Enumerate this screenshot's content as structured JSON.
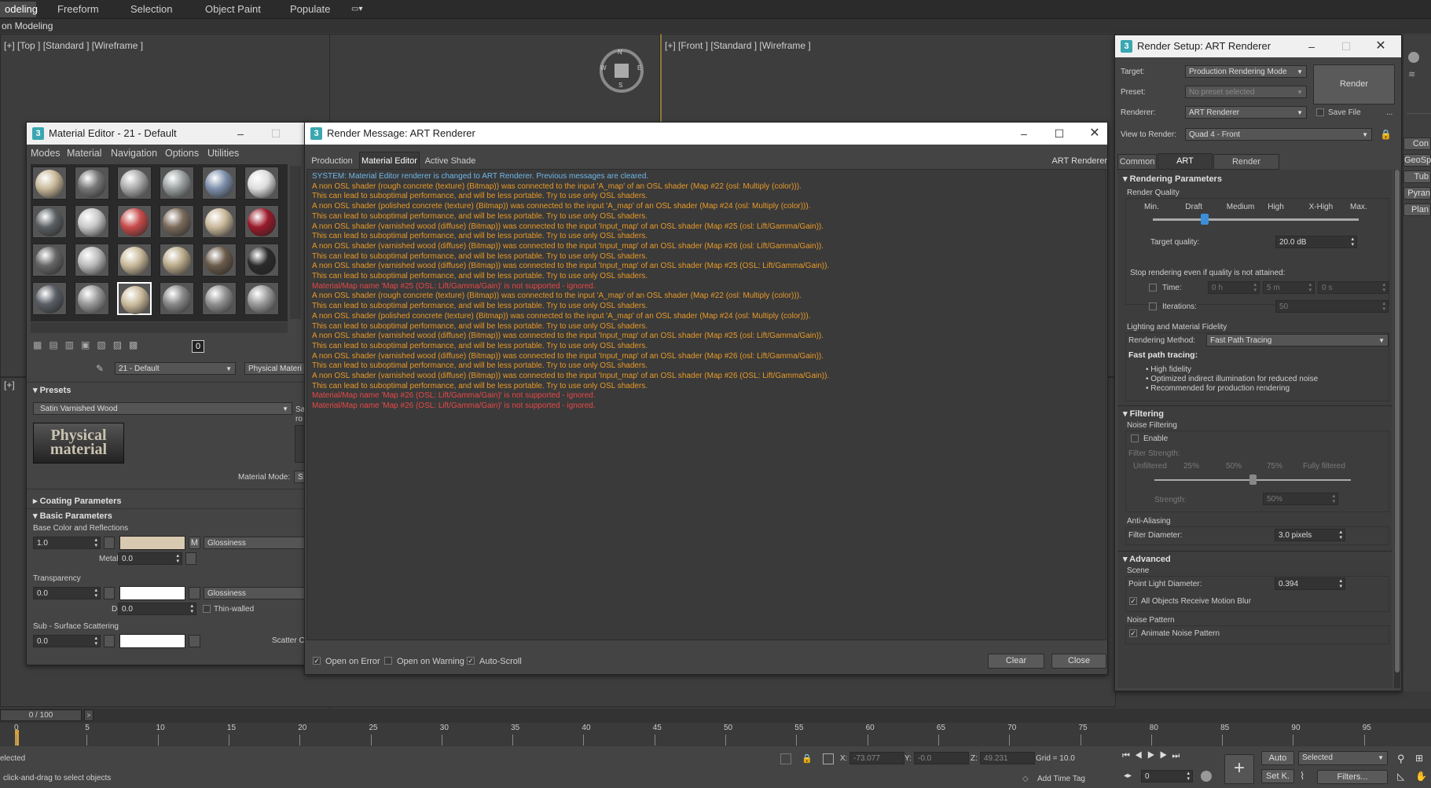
{
  "ribbon": {
    "tabs": [
      "odeling",
      "Freeform",
      "Selection",
      "Object Paint",
      "Populate"
    ],
    "sub_label": "on Modeling"
  },
  "viewports": {
    "top_label": "[+] [Top ] [Standard ] [Wireframe ]",
    "front_label": "[+] [Front ] [Standard ] [Wireframe ]",
    "third_label": "[+]",
    "compass": {
      "n": "N",
      "s": "S",
      "w": "W",
      "e": "E"
    }
  },
  "material_editor": {
    "title": "Material Editor - 21 - Default",
    "menu": [
      "Modes",
      "Material",
      "Navigation",
      "Options",
      "Utilities"
    ],
    "toolbar_count": "0",
    "material_name": "21 - Default",
    "material_type": "Physical Materi",
    "presets_label": "Presets",
    "preset_value": "Satin Varnished Wood",
    "logo_text": "Physical material",
    "material_mode_label": "Material Mode:",
    "material_mode_value": "S",
    "coating_label": "Coating Parameters",
    "basic_label": "Basic Parameters",
    "base_color_label": "Base Color and Reflections",
    "base_weight": "1.0",
    "m_label": "M",
    "glossiness_label": "Glossiness",
    "metalness_label": "Metalness:",
    "metalness_value": "0.0",
    "transparency_label": "Transparency",
    "transparency_value": "0.0",
    "glossiness2_label": "Glossiness",
    "depth_label": "Depth:",
    "depth_value": "0.0",
    "thin_walled_label": "Thin-walled",
    "sss_label": "Sub - Surface Scattering",
    "sss_value": "0.0",
    "scatter_label": "Scatter C",
    "side_text": [
      "Sa",
      "ro"
    ]
  },
  "render_message": {
    "title": "Render Message: ART Renderer",
    "tabs": [
      "Production",
      "Material Editor",
      "Active Shade"
    ],
    "renderer_label": "ART Renderer",
    "messages": [
      {
        "type": "sys",
        "text": "SYSTEM: Material Editor renderer is changed to ART Renderer. Previous messages are cleared."
      },
      {
        "type": "warn",
        "text": "A non OSL shader (rough concrete (texture) (Bitmap)) was connected to the input 'A_map' of an OSL shader (Map #22 (osl: Multiply (color)))."
      },
      {
        "type": "warn",
        "text": "This can lead to suboptimal performance, and will be less portable. Try to use only OSL shaders."
      },
      {
        "type": "warn",
        "text": "A non OSL shader (polished concrete (texture) (Bitmap)) was connected to the input 'A_map' of an OSL shader (Map #24 (osl: Multiply (color)))."
      },
      {
        "type": "warn",
        "text": "This can lead to suboptimal performance, and will be less portable. Try to use only OSL shaders."
      },
      {
        "type": "warn",
        "text": "A non OSL shader (varnished wood (diffuse) (Bitmap)) was connected to the input 'Input_map' of an OSL shader (Map #25 (osl: Lift/Gamma/Gain))."
      },
      {
        "type": "warn",
        "text": "This can lead to suboptimal performance, and will be less portable. Try to use only OSL shaders."
      },
      {
        "type": "warn",
        "text": "A non OSL shader (varnished wood (diffuse) (Bitmap)) was connected to the input 'Input_map' of an OSL shader (Map #26 (osl: Lift/Gamma/Gain))."
      },
      {
        "type": "warn",
        "text": "This can lead to suboptimal performance, and will be less portable. Try to use only OSL shaders."
      },
      {
        "type": "warn",
        "text": "A non OSL shader (varnished wood (diffuse) (Bitmap)) was connected to the input 'Input_map' of an OSL shader (Map #25 (OSL: Lift/Gamma/Gain))."
      },
      {
        "type": "warn",
        "text": "This can lead to suboptimal performance, and will be less portable. Try to use only OSL shaders."
      },
      {
        "type": "err",
        "text": "Material/Map name 'Map #25 (OSL: Lift/Gamma/Gain)' is not supported - ignored."
      },
      {
        "type": "warn",
        "text": "A non OSL shader (rough concrete (texture) (Bitmap)) was connected to the input 'A_map' of an OSL shader (Map #22 (osl: Multiply (color)))."
      },
      {
        "type": "warn",
        "text": "This can lead to suboptimal performance, and will be less portable. Try to use only OSL shaders."
      },
      {
        "type": "warn",
        "text": "A non OSL shader (polished concrete (texture) (Bitmap)) was connected to the input 'A_map' of an OSL shader (Map #24 (osl: Multiply (color)))."
      },
      {
        "type": "warn",
        "text": "This can lead to suboptimal performance, and will be less portable. Try to use only OSL shaders."
      },
      {
        "type": "warn",
        "text": "A non OSL shader (varnished wood (diffuse) (Bitmap)) was connected to the input 'Input_map' of an OSL shader (Map #25 (osl: Lift/Gamma/Gain))."
      },
      {
        "type": "warn",
        "text": "This can lead to suboptimal performance, and will be less portable. Try to use only OSL shaders."
      },
      {
        "type": "warn",
        "text": "A non OSL shader (varnished wood (diffuse) (Bitmap)) was connected to the input 'Input_map' of an OSL shader (Map #26 (osl: Lift/Gamma/Gain))."
      },
      {
        "type": "warn",
        "text": "This can lead to suboptimal performance, and will be less portable. Try to use only OSL shaders."
      },
      {
        "type": "warn",
        "text": "A non OSL shader (varnished wood (diffuse) (Bitmap)) was connected to the input 'Input_map' of an OSL shader (Map #26 (OSL: Lift/Gamma/Gain))."
      },
      {
        "type": "warn",
        "text": "This can lead to suboptimal performance, and will be less portable. Try to use only OSL shaders."
      },
      {
        "type": "err",
        "text": "Material/Map name 'Map #26 (OSL: Lift/Gamma/Gain)' is not supported - ignored."
      },
      {
        "type": "err",
        "text": "Material/Map name 'Map #26 (OSL: Lift/Gamma/Gain)' is not supported - ignored."
      }
    ],
    "open_on_error": "Open on Error",
    "open_on_warning": "Open on Warning",
    "auto_scroll": "Auto-Scroll",
    "clear_label": "Clear",
    "close_label": "Close"
  },
  "render_setup": {
    "title": "Render Setup: ART Renderer",
    "target_label": "Target:",
    "target_value": "Production Rendering Mode",
    "preset_label": "Preset:",
    "preset_value": "No preset selected",
    "renderer_label": "Renderer:",
    "renderer_value": "ART Renderer",
    "save_file_label": "Save File",
    "more_label": "...",
    "render_label": "Render",
    "view_label": "View to Render:",
    "view_value": "Quad 4 - Front",
    "tabs": [
      "Common",
      "ART Renderer",
      "Render Elements"
    ],
    "rendering_params": "Rendering Parameters",
    "render_quality": "Render Quality",
    "quality_levels": [
      "Min.",
      "Draft",
      "Medium",
      "High",
      "X-High",
      "Max."
    ],
    "quality_level": 0.1,
    "target_quality_label": "Target quality:",
    "target_quality_value": "20.0 dB",
    "stop_label": "Stop rendering even if quality is not attained:",
    "time_label": "Time:",
    "time_values": [
      "0 h",
      "5 m",
      "0 s"
    ],
    "iterations_label": "Iterations:",
    "iterations_value": "50",
    "lighting_label": "Lighting and Material Fidelity",
    "method_label": "Rendering Method:",
    "method_value": "Fast Path Tracing",
    "fast_path_label": "Fast path tracing:",
    "fast_path_bullets": [
      "High fidelity",
      "Optimized indirect illumination for reduced noise",
      "Recommended for production rendering"
    ],
    "filtering_label": "Filtering",
    "noise_filtering_label": "Noise Filtering",
    "enable_label": "Enable",
    "filter_strength_label": "Filter Strength:",
    "filter_levels": [
      "Unfiltered",
      "25%",
      "50%",
      "75%",
      "Fully filtered"
    ],
    "filter_strength_level": 0.5,
    "strength_label": "Strength:",
    "strength_value": "50%",
    "antialiasing_label": "Anti-Aliasing",
    "filter_diameter_label": "Filter Diameter:",
    "filter_diameter_value": "3.0 pixels",
    "advanced_label": "Advanced",
    "scene_label": "Scene",
    "point_light_label": "Point Light Diameter:",
    "point_light_value": "0.394",
    "motion_blur_label": "All Objects Receive Motion Blur",
    "noise_pattern_label": "Noise Pattern",
    "animate_noise_label": "Animate Noise Pattern"
  },
  "right_panel": [
    "Con",
    "GeoSph",
    "Tub",
    "Pyran",
    "Plan"
  ],
  "timeline": {
    "frame_label": "0 / 100",
    "ticks": [
      "0",
      "5",
      "10",
      "15",
      "20",
      "25",
      "30",
      "35",
      "40",
      "45",
      "50",
      "55",
      "60",
      "65",
      "70",
      "75",
      "80",
      "85",
      "90",
      "95",
      "10"
    ]
  },
  "status": {
    "selected_text": "elected",
    "hint_text": "click-and-drag to select objects",
    "x_label": "X:",
    "x_value": "-73.077",
    "y_label": "Y:",
    "y_value": "-0.0",
    "z_label": "Z:",
    "z_value": "49.231",
    "grid_label": "Grid = 10.0",
    "add_time_tag": "Add Time Tag",
    "auto_label": "Auto",
    "setk_label": "Set K.",
    "selected_dd": "Selected",
    "filters_label": "Filters...",
    "frame_spinner": "0"
  }
}
